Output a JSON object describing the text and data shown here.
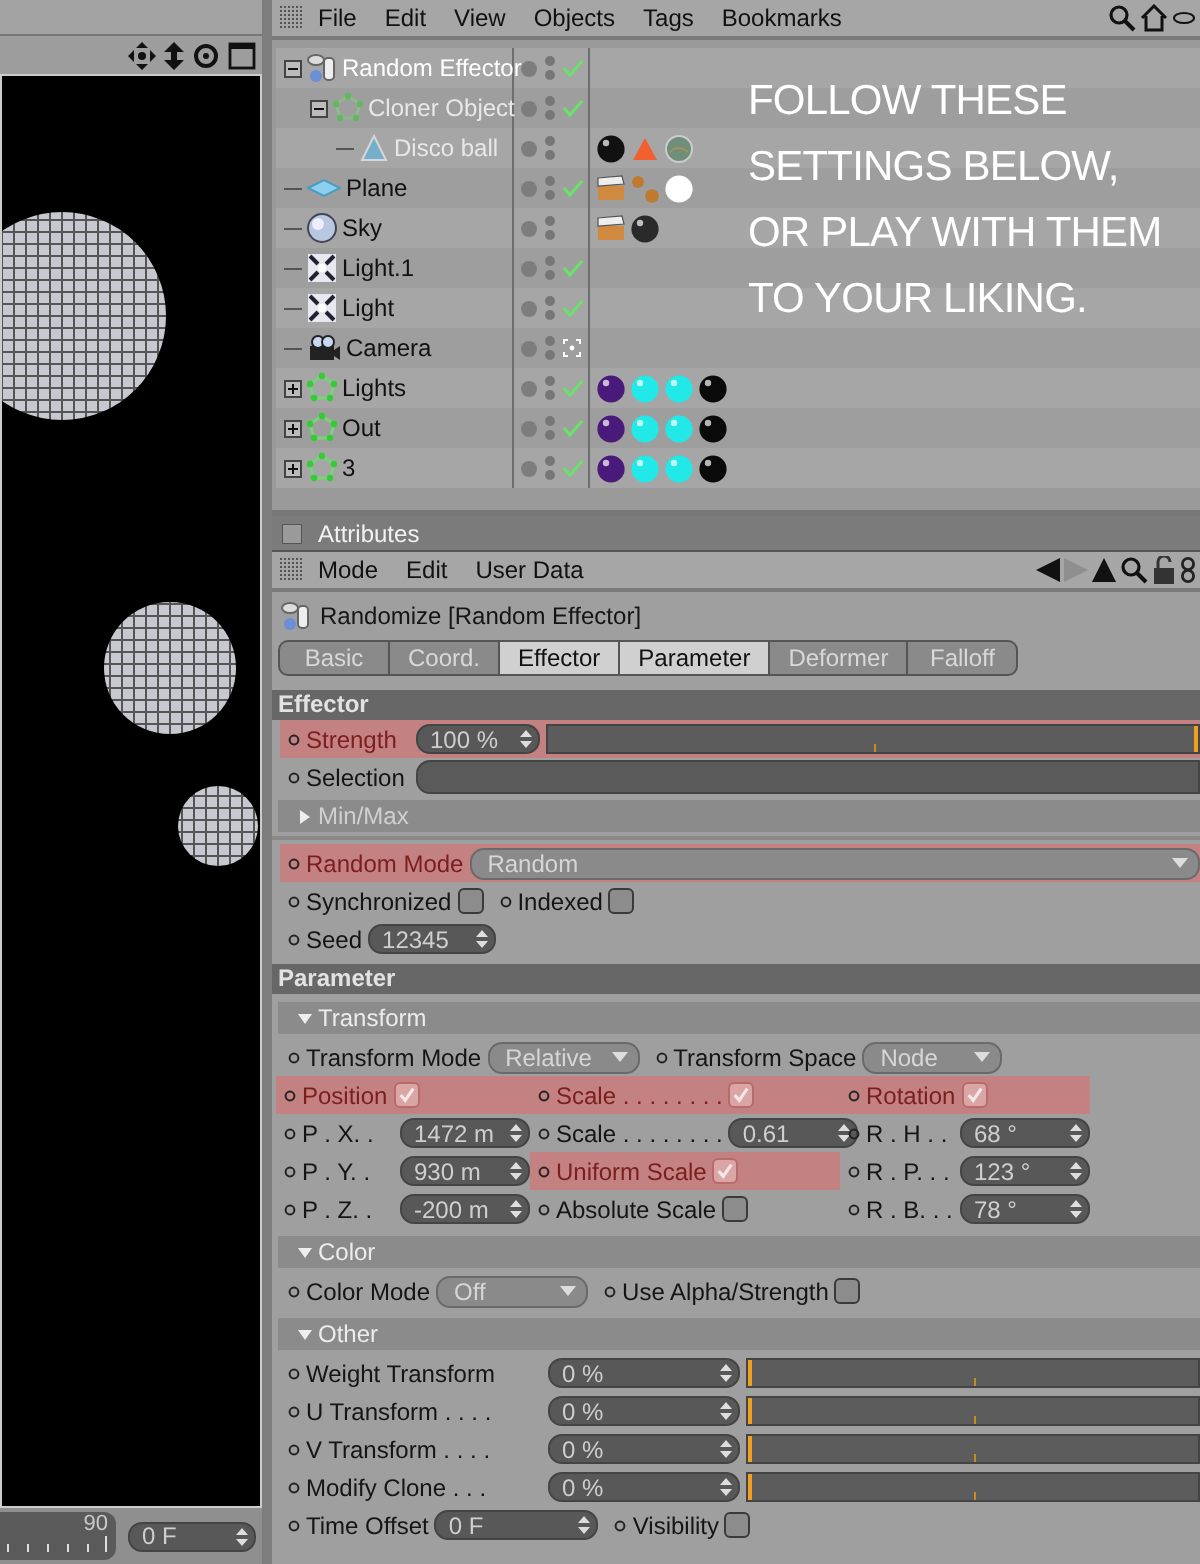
{
  "viewport": {
    "timeline_end": "90",
    "frame_field": "0 F"
  },
  "object_manager": {
    "menu": [
      "File",
      "Edit",
      "View",
      "Objects",
      "Tags",
      "Bookmarks"
    ],
    "objects": [
      {
        "name": "Random Effector",
        "kind": "effector",
        "expanded": true,
        "selected": true,
        "disabled": false,
        "enabled": true,
        "children": [
          {
            "name": "Cloner Object",
            "kind": "cloner",
            "expanded": true,
            "selected": false,
            "disabled": true,
            "enabled": true,
            "children": [
              {
                "name": "Disco ball",
                "kind": "cone",
                "selected": false,
                "disabled": true,
                "enabled": false,
                "tags": [
                  {
                    "kind": "material",
                    "color": "#111111"
                  },
                  {
                    "kind": "cone"
                  },
                  {
                    "kind": "globe"
                  }
                ]
              }
            ]
          }
        ]
      },
      {
        "name": "Plane",
        "kind": "plane",
        "selected": false,
        "disabled": false,
        "enabled": true,
        "tags": [
          {
            "kind": "clapper"
          },
          {
            "kind": "dots"
          },
          {
            "kind": "material",
            "color": "#ffffff"
          }
        ]
      },
      {
        "name": "Sky",
        "kind": "sky",
        "selected": false,
        "disabled": false,
        "enabled": false,
        "tags": [
          {
            "kind": "clapper"
          },
          {
            "kind": "material",
            "color": "#2a2a2a"
          }
        ]
      },
      {
        "name": "Light.1",
        "kind": "light",
        "selected": false,
        "disabled": false,
        "enabled": true
      },
      {
        "name": "Light",
        "kind": "light",
        "selected": false,
        "disabled": false,
        "enabled": true
      },
      {
        "name": "Camera",
        "kind": "camera",
        "selected": false,
        "disabled": false,
        "enabled": false
      },
      {
        "name": "Lights",
        "kind": "cloner",
        "expanded": false,
        "selected": false,
        "disabled": false,
        "enabled": true,
        "tags": [
          {
            "kind": "material",
            "color": "#4a1a7a"
          },
          {
            "kind": "material",
            "color": "#22e8e8"
          },
          {
            "kind": "material",
            "color": "#22e8e8"
          },
          {
            "kind": "material",
            "color": "#0a0a0a"
          }
        ]
      },
      {
        "name": "Out",
        "kind": "cloner",
        "expanded": false,
        "selected": false,
        "disabled": false,
        "enabled": true,
        "tags": [
          {
            "kind": "material",
            "color": "#4a1a7a"
          },
          {
            "kind": "material",
            "color": "#22e8e8"
          },
          {
            "kind": "material",
            "color": "#22e8e8"
          },
          {
            "kind": "material",
            "color": "#0a0a0a"
          }
        ]
      },
      {
        "name": "3",
        "kind": "cloner",
        "expanded": false,
        "selected": false,
        "disabled": false,
        "enabled": true,
        "tags": [
          {
            "kind": "material",
            "color": "#4a1a7a"
          },
          {
            "kind": "material",
            "color": "#22e8e8"
          },
          {
            "kind": "material",
            "color": "#22e8e8"
          },
          {
            "kind": "material",
            "color": "#0a0a0a"
          }
        ]
      }
    ]
  },
  "annotation": "FOLLOW THESE\nSETTINGS BELOW,\nOR PLAY WITH THEM\nTO YOUR LIKING.",
  "attributes": {
    "title": "Attributes",
    "menu": [
      "Mode",
      "Edit",
      "User Data"
    ],
    "object_title": "Randomize [Random Effector]",
    "tabs": [
      {
        "label": "Basic",
        "selected": false
      },
      {
        "label": "Coord.",
        "selected": false
      },
      {
        "label": "Effector",
        "selected": true
      },
      {
        "label": "Parameter",
        "selected": true
      },
      {
        "label": "Deformer",
        "selected": false
      },
      {
        "label": "Falloff",
        "selected": false
      }
    ],
    "sections": [
      {
        "title": "Effector",
        "blocks": [
          {
            "kind": "slider",
            "label": "Strength",
            "value": "100 %",
            "level": 1,
            "highlighted": true
          },
          {
            "kind": "bar",
            "label": "Selection",
            "highlighted": false
          },
          {
            "kind": "group",
            "title": "Min/Max",
            "expanded": false
          },
          {
            "kind": "dropdown",
            "label": "Random Mode",
            "value": "Random",
            "highlighted": true
          },
          {
            "kind": "line",
            "items": [
              {
                "kind": "checkbox",
                "label": "Synchronized",
                "checked": false,
                "highlighted": false
              },
              {
                "kind": "checkbox",
                "label": "Indexed",
                "checked": false,
                "highlighted": false
              }
            ]
          },
          {
            "kind": "number",
            "label": "Seed",
            "value": "12345",
            "highlighted": false
          }
        ]
      },
      {
        "title": "Parameter",
        "blocks": [
          {
            "kind": "group",
            "title": "Transform",
            "expanded": true,
            "blocks": [
              {
                "kind": "line",
                "items": [
                  {
                    "kind": "dropdown",
                    "label": "Transform Mode",
                    "value": "Relative",
                    "highlighted": false
                  },
                  {
                    "kind": "dropdown",
                    "label": "Transform Space",
                    "value": "Node",
                    "highlighted": false
                  }
                ]
              },
              {
                "kind": "grid",
                "rows": [
                  [
                    {
                      "kind": "checkbox",
                      "label": "Position",
                      "checked": true,
                      "highlighted": true
                    },
                    {
                      "kind": "checkbox",
                      "label": "Scale . . . . . . . .",
                      "checked": true,
                      "highlighted": true
                    },
                    {
                      "kind": "checkbox",
                      "label": "Rotation",
                      "checked": true,
                      "highlighted": true
                    }
                  ],
                  [
                    {
                      "kind": "number",
                      "label": "P . X. .",
                      "value": "1472 m",
                      "highlighted": false
                    },
                    {
                      "kind": "number",
                      "label": "Scale . . . . . . . .",
                      "value": "0.61",
                      "highlighted": false
                    },
                    {
                      "kind": "number",
                      "label": "R . H . .",
                      "value": "68 °",
                      "highlighted": false
                    }
                  ],
                  [
                    {
                      "kind": "number",
                      "label": "P . Y. .",
                      "value": "930 m",
                      "highlighted": false
                    },
                    {
                      "kind": "checkbox",
                      "label": "Uniform Scale",
                      "checked": true,
                      "highlighted": true
                    },
                    {
                      "kind": "number",
                      "label": "R . P. . .",
                      "value": "123 °",
                      "highlighted": false
                    }
                  ],
                  [
                    {
                      "kind": "number",
                      "label": "P . Z. .",
                      "value": "-200 m",
                      "highlighted": false
                    },
                    {
                      "kind": "checkbox",
                      "label": "Absolute Scale",
                      "checked": false,
                      "highlighted": false
                    },
                    {
                      "kind": "number",
                      "label": "R . B. . .",
                      "value": "78 °",
                      "highlighted": false
                    }
                  ]
                ]
              }
            ]
          },
          {
            "kind": "group",
            "title": "Color",
            "expanded": true,
            "blocks": [
              {
                "kind": "line",
                "items": [
                  {
                    "kind": "dropdown",
                    "label": "Color Mode",
                    "value": "Off",
                    "highlighted": false
                  },
                  {
                    "kind": "checkbox",
                    "label": "Use Alpha/Strength",
                    "checked": false,
                    "highlighted": false
                  }
                ]
              }
            ]
          },
          {
            "kind": "group",
            "title": "Other",
            "expanded": true,
            "blocks": [
              {
                "kind": "slider",
                "label": "Weight Transform",
                "value": "0 %",
                "level": 0,
                "highlighted": false
              },
              {
                "kind": "slider",
                "label": "U Transform . . . .",
                "value": "0 %",
                "level": 0,
                "highlighted": false
              },
              {
                "kind": "slider",
                "label": "V Transform . . . .",
                "value": "0 %",
                "level": 0,
                "highlighted": false
              },
              {
                "kind": "slider",
                "label": "Modify Clone . . .",
                "value": "0 %",
                "level": 0,
                "highlighted": false
              },
              {
                "kind": "line",
                "items": [
                  {
                    "kind": "number",
                    "label": "Time Offset",
                    "value": "0 F",
                    "highlighted": false
                  },
                  {
                    "kind": "checkbox",
                    "label": "Visibility",
                    "checked": false,
                    "highlighted": false
                  }
                ]
              }
            ]
          }
        ]
      }
    ]
  }
}
